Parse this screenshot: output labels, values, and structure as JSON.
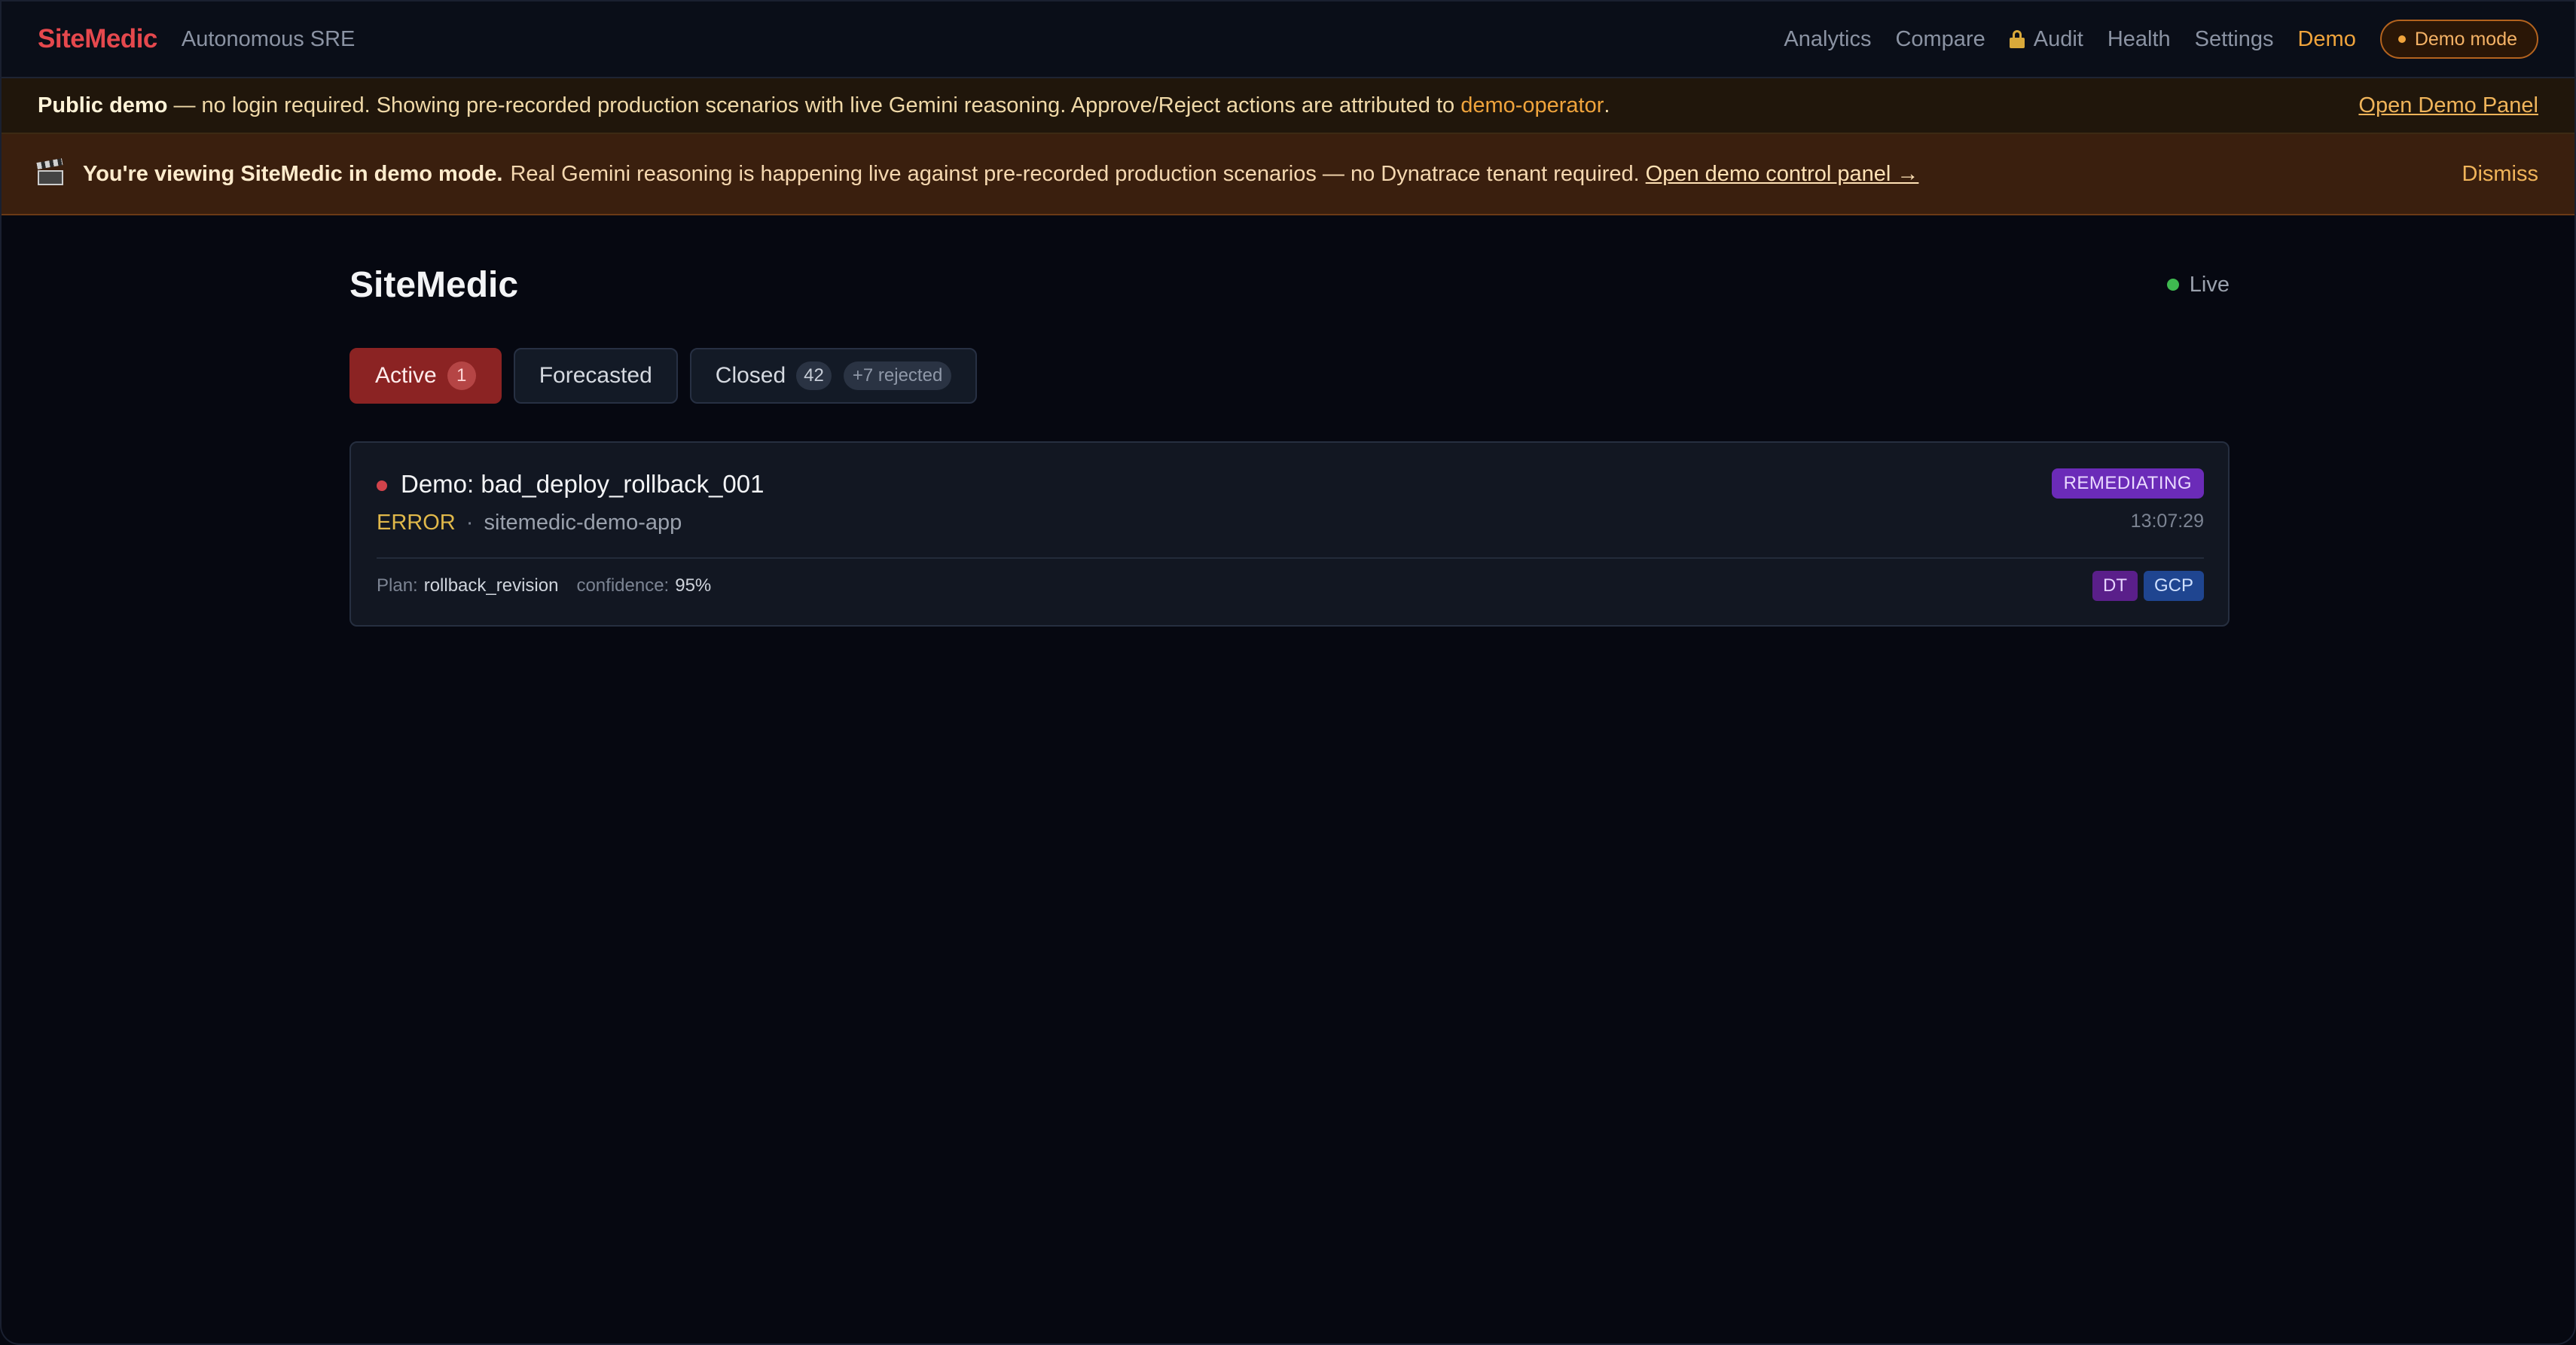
{
  "nav": {
    "brand": "SiteMedic",
    "tagline": "Autonomous SRE",
    "links": [
      "Analytics",
      "Compare",
      "Audit",
      "Health",
      "Settings",
      "Demo"
    ],
    "demo_pill": "Demo mode"
  },
  "public_banner": {
    "bold": "Public demo",
    "text": " — no login required. Showing pre-recorded production scenarios with live Gemini reasoning. Approve/Reject actions are attributed to ",
    "operator": "demo-operator",
    "end": ".",
    "open_panel": "Open Demo Panel"
  },
  "mode_banner": {
    "bold": "You're viewing SiteMedic in demo mode.",
    "text": "Real Gemini reasoning is happening live against pre-recorded production scenarios — no Dynatrace tenant required.",
    "link": "Open demo control panel →",
    "dismiss": "Dismiss"
  },
  "page": {
    "title": "SiteMedic",
    "live_label": "Live"
  },
  "tabs": [
    {
      "label": "Active",
      "count": "1"
    },
    {
      "label": "Forecasted"
    },
    {
      "label": "Closed",
      "count": "42",
      "extra": "+7 rejected"
    }
  ],
  "incident": {
    "title": "Demo: bad_deploy_rollback_001",
    "severity": "ERROR",
    "separator": "·",
    "service": "sitemedic-demo-app",
    "status": "REMEDIATING",
    "time": "13:07:29",
    "plan_label": "Plan:",
    "plan_value": "rollback_revision",
    "confidence_label": "confidence:",
    "confidence_value": "95%",
    "tags": [
      "DT",
      "GCP"
    ]
  },
  "colors": {
    "brand": "#e5484d",
    "accent": "#f0a43c",
    "active_tab": "#8b2323",
    "status_badge": "#6b2bb8",
    "live": "#3fb950"
  }
}
